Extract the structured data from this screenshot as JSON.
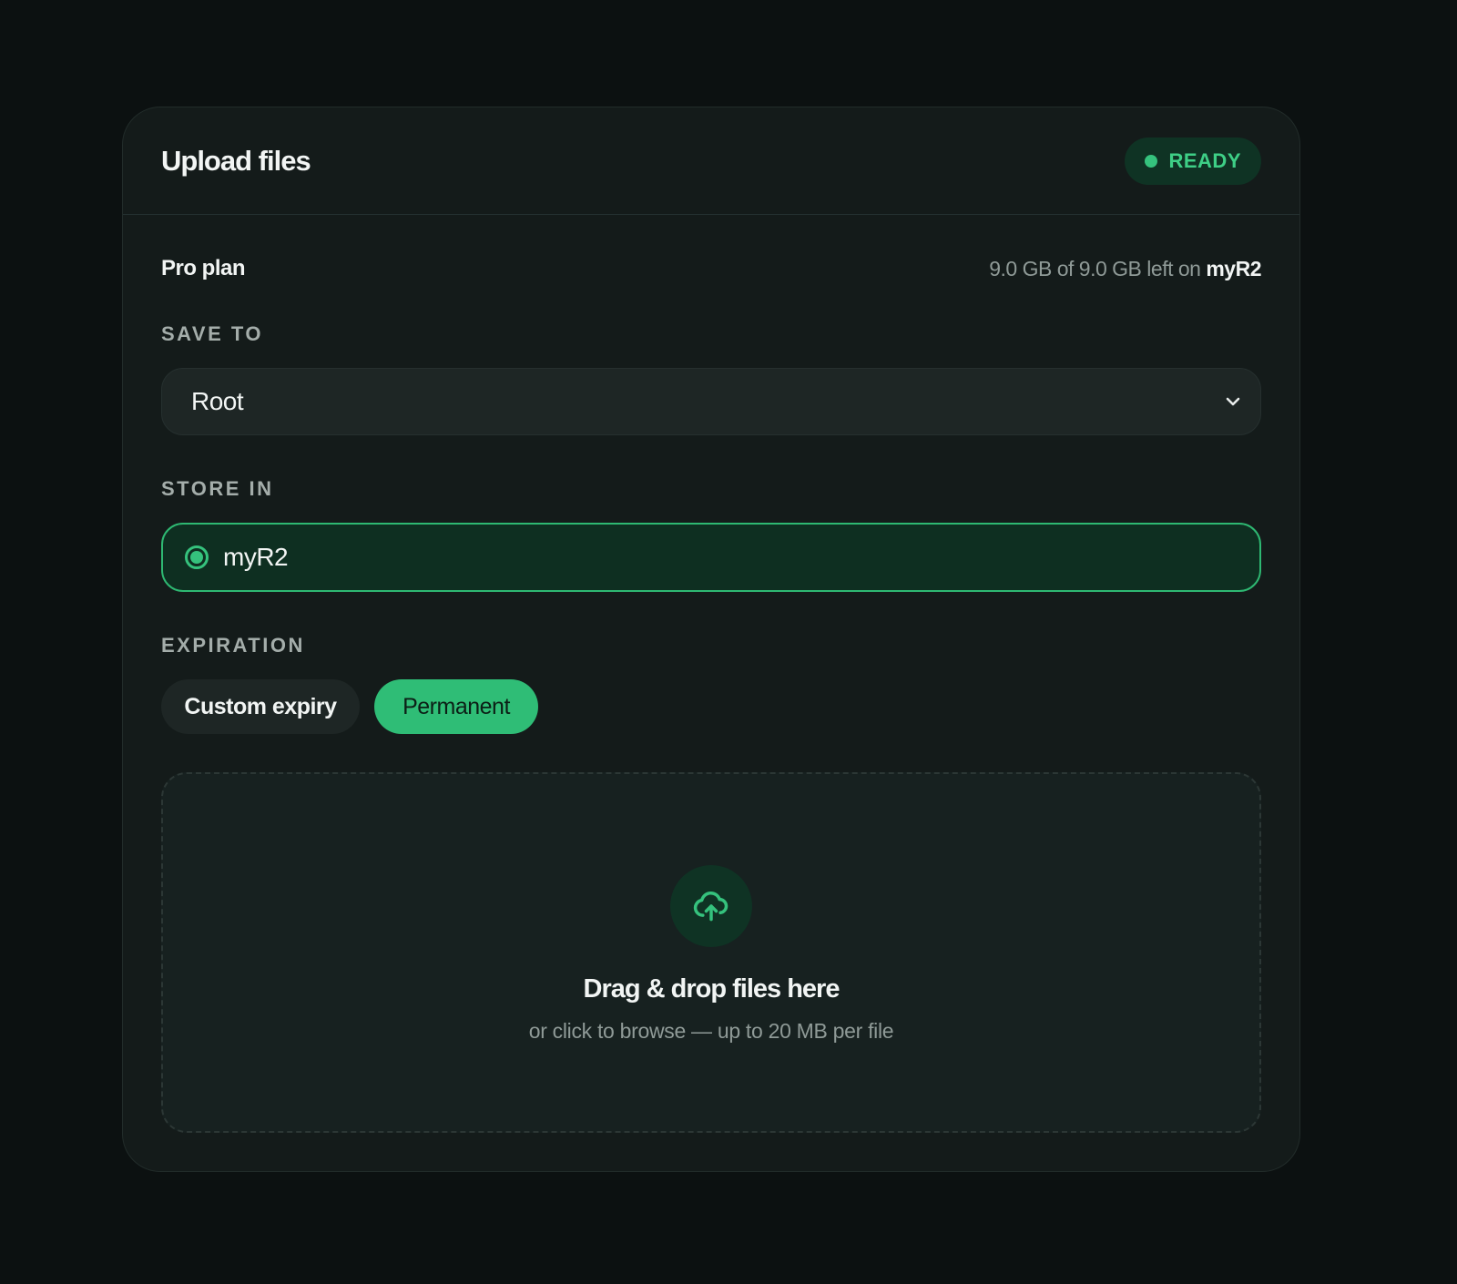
{
  "header": {
    "title": "Upload files",
    "status": "READY"
  },
  "plan": {
    "name": "Pro plan",
    "quota_text": "9.0 GB of 9.0 GB left on",
    "quota_target": "myR2"
  },
  "save_to": {
    "label": "SAVE TO",
    "selected": "Root"
  },
  "store_in": {
    "label": "STORE IN",
    "selected": "myR2"
  },
  "expiration": {
    "label": "EXPIRATION",
    "options": [
      "Custom expiry",
      "Permanent"
    ],
    "selected": "Permanent"
  },
  "dropzone": {
    "title": "Drag & drop files here",
    "subtitle": "or click to browse — up to 20 MB per file"
  },
  "icons": {
    "status": "status-dot-icon",
    "select": "chevron-down-icon",
    "radio": "radio-selected-icon",
    "dropzone": "cloud-upload-icon"
  },
  "colors": {
    "background": "#0c1111",
    "card": "#141b1a",
    "accent": "#35c27d",
    "accent_dark": "#0f3324",
    "text": "#f2f5f4",
    "muted": "#8f9a97"
  }
}
